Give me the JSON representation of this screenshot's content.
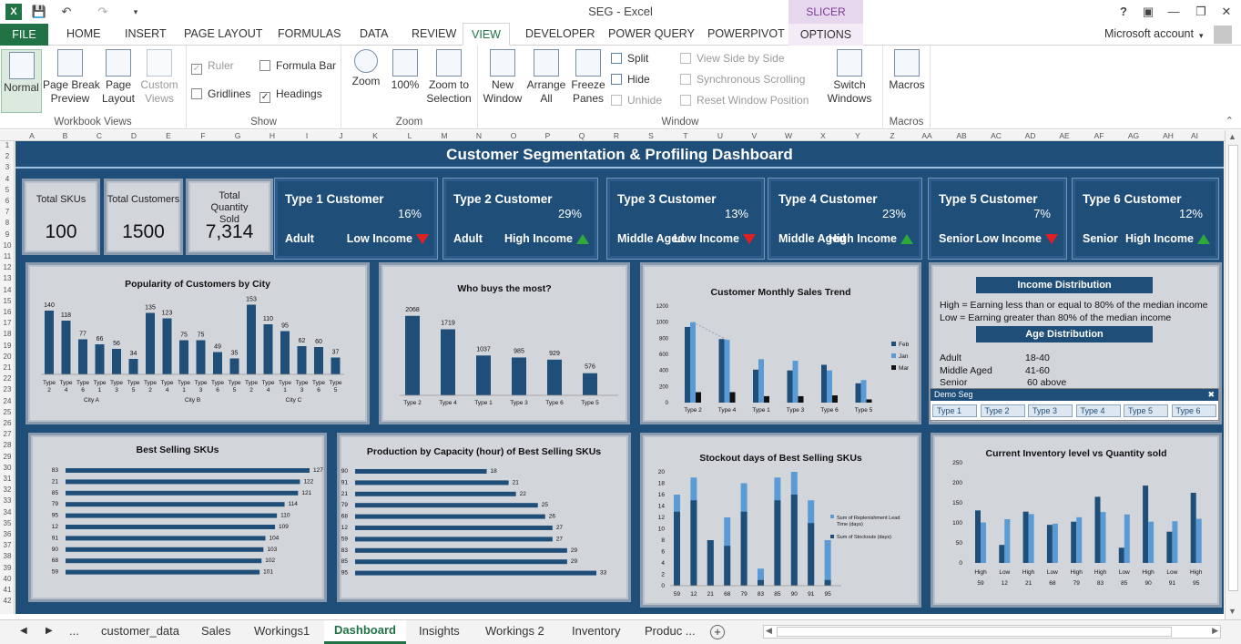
{
  "window": {
    "title": "SEG - Excel",
    "context_tab": "SLICER TOOLS",
    "account": "Microsoft account"
  },
  "tabs": [
    "FILE",
    "HOME",
    "INSERT",
    "PAGE LAYOUT",
    "FORMULAS",
    "DATA",
    "REVIEW",
    "VIEW",
    "DEVELOPER",
    "POWER QUERY",
    "POWERPIVOT",
    "OPTIONS"
  ],
  "ribbon": {
    "workbook_views": {
      "label": "Workbook Views",
      "normal": "Normal",
      "page_break": "Page Break\nPreview",
      "page_layout": "Page\nLayout",
      "custom": "Custom\nViews"
    },
    "show": {
      "label": "Show",
      "ruler": "Ruler",
      "formula_bar": "Formula Bar",
      "gridlines": "Gridlines",
      "headings": "Headings"
    },
    "zoom": {
      "label": "Zoom",
      "zoom": "Zoom",
      "hundred": "100%",
      "zoom_sel": "Zoom to\nSelection"
    },
    "window": {
      "label": "Window",
      "new": "New\nWindow",
      "arrange": "Arrange\nAll",
      "freeze": "Freeze\nPanes",
      "split": "Split",
      "hide": "Hide",
      "unhide": "Unhide",
      "side": "View Side by Side",
      "sync": "Synchronous Scrolling",
      "reset": "Reset Window Position",
      "switch": "Switch\nWindows"
    },
    "macros": {
      "label": "Macros",
      "macros": "Macros"
    }
  },
  "columns": [
    "A",
    "B",
    "C",
    "D",
    "E",
    "F",
    "G",
    "H",
    "I",
    "J",
    "K",
    "L",
    "M",
    "N",
    "O",
    "P",
    "Q",
    "R",
    "S",
    "T",
    "U",
    "V",
    "W",
    "X",
    "Y",
    "Z",
    "AA",
    "AB",
    "AC",
    "AD",
    "AE",
    "AF",
    "AG",
    "AH",
    "AI"
  ],
  "dashboard": {
    "title": "Customer Segmentation & Profiling Dashboard",
    "kpis": [
      {
        "label": "Total SKUs",
        "value": "100"
      },
      {
        "label": "Total Customers",
        "value": "1500"
      },
      {
        "label": "Total Quantity Sold",
        "value": "7,314"
      }
    ],
    "customers": [
      {
        "title": "Type 1 Customer",
        "pct": "16%",
        "age": "Adult",
        "income": "Low Income",
        "trend": "down"
      },
      {
        "title": "Type 2 Customer",
        "pct": "29%",
        "age": "Adult",
        "income": "High Income",
        "trend": "up"
      },
      {
        "title": "Type 3 Customer",
        "pct": "13%",
        "age": "Middle Aged",
        "income": "Low Income",
        "trend": "down"
      },
      {
        "title": "Type 4 Customer",
        "pct": "23%",
        "age": "Middle Aged",
        "income": "High Income",
        "trend": "up"
      },
      {
        "title": "Type 5 Customer",
        "pct": "7%",
        "age": "Senior",
        "income": "Low Income",
        "trend": "down"
      },
      {
        "title": "Type 6 Customer",
        "pct": "12%",
        "age": "Senior",
        "income": "High Income",
        "trend": "up"
      }
    ],
    "info": {
      "income_head": "Income Distribution",
      "income_lines": [
        "High = Earning less than or equal to 80% of the median income",
        "Low = Earning greater than 80% of the median income"
      ],
      "age_head": "Age Distribution",
      "ages": [
        {
          "k": "Adult",
          "v": "18-40"
        },
        {
          "k": "Middle Aged",
          "v": "41-60"
        },
        {
          "k": "Senior",
          "v": "60 above"
        }
      ],
      "slicer_title": "Demo Seg",
      "slicer_items": [
        "Type 1",
        "Type 2",
        "Type 3",
        "Type 4",
        "Type 5",
        "Type 6"
      ]
    }
  },
  "chart_data": [
    {
      "type": "bar",
      "title": "Popularity of Customers by City",
      "categories": [
        "Type 2",
        "Type 4",
        "Type 6",
        "Type 1",
        "Type 3",
        "Type 5",
        "Type 2",
        "Type 4",
        "Type 1",
        "Type 3",
        "Type 6",
        "Type 5",
        "Type 2",
        "Type 4",
        "Type 1",
        "Type 3",
        "Type 6",
        "Type 5"
      ],
      "groups": [
        "City A",
        "City B",
        "City C"
      ],
      "values": [
        140,
        118,
        77,
        66,
        56,
        34,
        135,
        123,
        75,
        75,
        49,
        35,
        153,
        110,
        95,
        62,
        60,
        37
      ],
      "ylim": [
        0,
        160
      ]
    },
    {
      "type": "bar",
      "title": "Who buys the most?",
      "categories": [
        "Type 2",
        "Type 4",
        "Type 1",
        "Type 3",
        "Type 6",
        "Type 5"
      ],
      "values": [
        2068,
        1719,
        1037,
        985,
        929,
        576
      ],
      "ylim": [
        0,
        2300
      ]
    },
    {
      "type": "bar",
      "title": "Customer Monthly Sales Trend",
      "categories": [
        "Type 2",
        "Type 4",
        "Type 1",
        "Type 3",
        "Type 6",
        "Type 5"
      ],
      "series": [
        {
          "name": "Feb",
          "values": [
            940,
            790,
            410,
            400,
            470,
            240
          ]
        },
        {
          "name": "Jan",
          "values": [
            1000,
            780,
            540,
            520,
            400,
            280
          ]
        },
        {
          "name": "Mar",
          "values": [
            130,
            130,
            80,
            80,
            90,
            40
          ]
        }
      ],
      "yticks": [
        0,
        200,
        400,
        600,
        800,
        1000,
        1200
      ],
      "ylim": [
        0,
        1200
      ]
    },
    {
      "type": "bar",
      "title": "Best Selling SKUs",
      "categories": [
        "83",
        "21",
        "85",
        "79",
        "95",
        "12",
        "91",
        "90",
        "68",
        "59"
      ],
      "values": [
        127,
        122,
        121,
        114,
        110,
        109,
        104,
        103,
        102,
        101
      ],
      "orientation": "horizontal"
    },
    {
      "type": "bar",
      "title": "Production by Capacity (hour) of Best Selling SKUs",
      "categories": [
        "90",
        "91",
        "21",
        "79",
        "68",
        "12",
        "59",
        "83",
        "85",
        "95"
      ],
      "values": [
        18,
        21,
        22,
        25,
        26,
        27,
        27,
        29,
        29,
        33
      ],
      "orientation": "horizontal"
    },
    {
      "type": "bar",
      "title": "Stockout days of Best Selling SKUs",
      "categories": [
        "59",
        "12",
        "21",
        "68",
        "79",
        "83",
        "85",
        "90",
        "91",
        "95"
      ],
      "series": [
        {
          "name": "Sum of Replenishment Lead Time (days)",
          "values": [
            16,
            19,
            8,
            12,
            18,
            3,
            19,
            20,
            15,
            8
          ]
        },
        {
          "name": "Sum of Stockouts (days)",
          "values": [
            13,
            15,
            8,
            7,
            13,
            1,
            15,
            16,
            11,
            1
          ]
        }
      ],
      "yticks": [
        0,
        2,
        4,
        6,
        8,
        10,
        12,
        14,
        16,
        18,
        20
      ],
      "ylim": [
        0,
        20
      ]
    },
    {
      "type": "bar",
      "title": "Current Inventory level vs Quantity sold",
      "categories": [
        "High",
        "Low",
        "High",
        "Low",
        "High",
        "High",
        "Low",
        "High",
        "Low",
        "High"
      ],
      "categories2": [
        "59",
        "12",
        "21",
        "68",
        "79",
        "83",
        "85",
        "90",
        "91",
        "95"
      ],
      "series": [
        {
          "name": "Inventory",
          "values": [
            131,
            45,
            128,
            95,
            103,
            165,
            38,
            193,
            78,
            175
          ]
        },
        {
          "name": "Quantity sold",
          "values": [
            101,
            109,
            122,
            98,
            114,
            127,
            121,
            103,
            104,
            110
          ]
        }
      ],
      "yticks": [
        0,
        50,
        100,
        150,
        200,
        250
      ],
      "ylim": [
        0,
        250
      ]
    }
  ],
  "sheets": [
    "customer_data",
    "Sales",
    "Workings1",
    "Dashboard",
    "Insights",
    "Workings 2",
    "Inventory",
    "Produc ..."
  ],
  "colors": {
    "excel_green": "#217346",
    "navy": "#1f4e79",
    "light_bar": "#5b9bd5",
    "panel": "#d2d5da"
  }
}
